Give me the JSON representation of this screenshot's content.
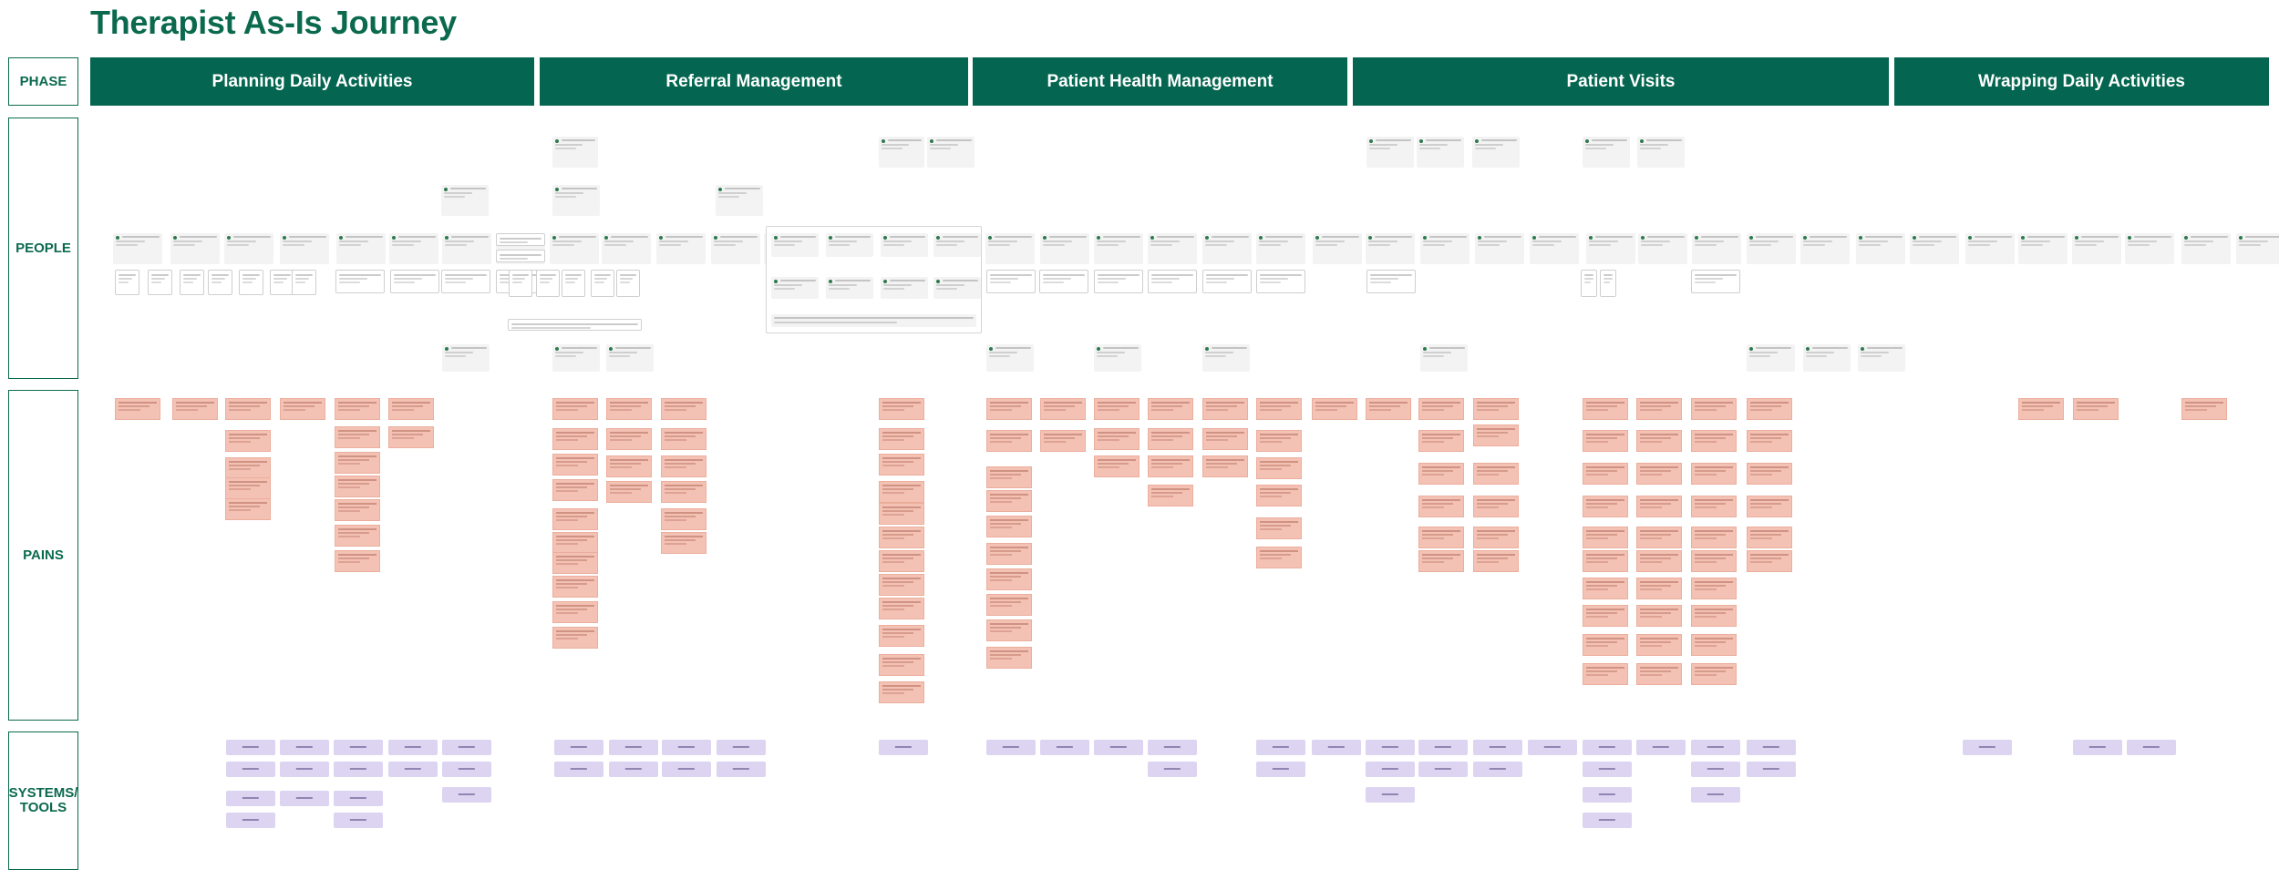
{
  "title": "Therapist As-Is Journey",
  "row_labels": {
    "phase": "PHASE",
    "people": "PEOPLE",
    "pains": "PAINS",
    "systems": "SYSTEMS/\nTOOLS"
  },
  "phases": [
    "Planning Daily Activities",
    "Referral Management",
    "Patient Health Management",
    "Patient Visits",
    "Wrapping Daily Activities"
  ],
  "colors": {
    "brand_green": "#046650",
    "title_green": "#0b6a4e",
    "people_card": "#f3f3f3",
    "pain_card": "#f4c2b4",
    "tool_card": "#dcd4f1"
  }
}
